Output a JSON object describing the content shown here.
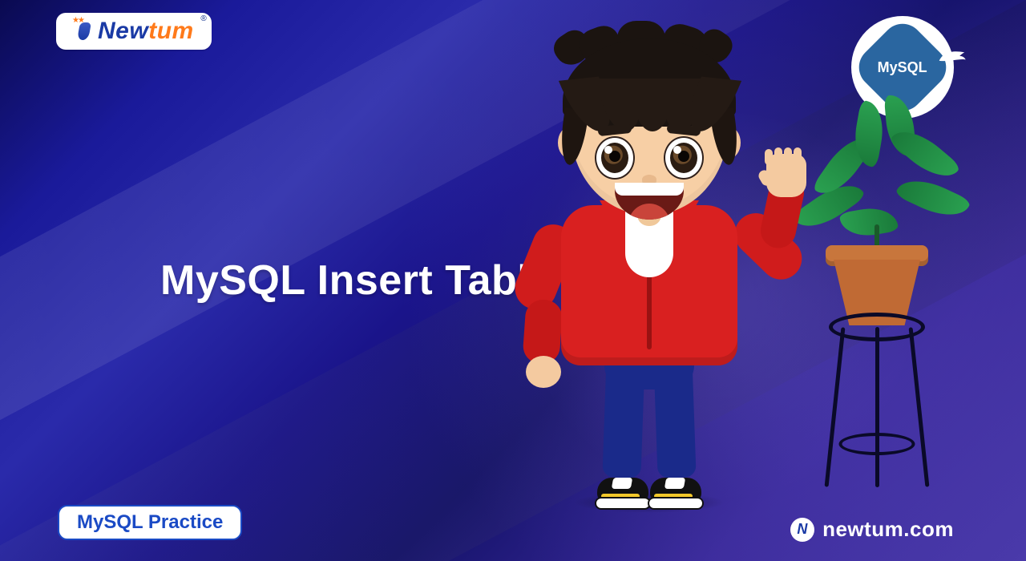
{
  "logo": {
    "brand_prefix": "N",
    "brand_mid": "ew",
    "brand_suffix": "tum",
    "registered": "®"
  },
  "badge_tag": {
    "label": "MySQL Practice"
  },
  "headline": {
    "text": "MySQL Insert Table"
  },
  "tech_badge": {
    "label": "MySQL"
  },
  "footer": {
    "domain": "newtum.com",
    "mini_mark": "N"
  }
}
